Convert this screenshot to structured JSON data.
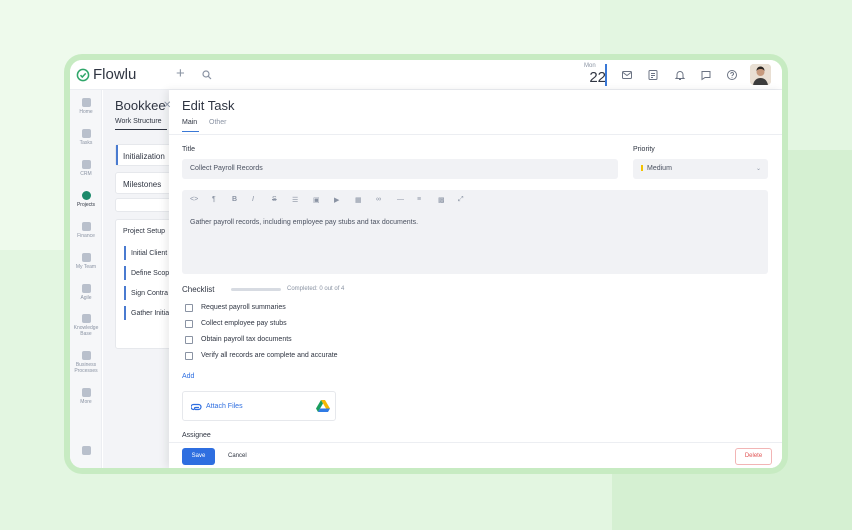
{
  "app": {
    "brand": "Flowlu",
    "date_dow": "Mon",
    "date_day": "22"
  },
  "leftnav": [
    {
      "label": "Home"
    },
    {
      "label": "Tasks"
    },
    {
      "label": "CRM"
    },
    {
      "label": "Projects"
    },
    {
      "label": "Finance"
    },
    {
      "label": "My Team"
    },
    {
      "label": "Agile"
    },
    {
      "label": "Knowledge Base"
    },
    {
      "label": "Business Processes"
    },
    {
      "label": "More"
    }
  ],
  "bgpage": {
    "title": "Bookkee",
    "tab": "Work Structure",
    "init": "Initialization",
    "milestones": "Milestones",
    "setup_title": "Project Setup",
    "rows": [
      "Initial Client",
      "Define Scop",
      "Sign Contra",
      "Gather Initia"
    ]
  },
  "modal": {
    "title": "Edit Task",
    "tabs": [
      "Main",
      "Other"
    ],
    "title_label": "Title",
    "title_value": "Collect Payroll Records",
    "priority_label": "Priority",
    "priority_value": "Medium",
    "description": "Gather payroll records, including employee pay stubs and tax documents.",
    "checklist_label": "Checklist",
    "checklist_status": "Completed: 0 out of 4",
    "checklist": [
      "Request payroll summaries",
      "Collect employee pay stubs",
      "Obtain payroll tax documents",
      "Verify all records are complete and accurate"
    ],
    "add_label": "Add",
    "attach_label": "Attach Files",
    "assignee_label": "Assignee",
    "save": "Save",
    "cancel": "Cancel",
    "delete": "Delete"
  },
  "colors": {
    "accent": "#2e6ee0",
    "priority": "#f2c200",
    "delete": "#e05252"
  }
}
